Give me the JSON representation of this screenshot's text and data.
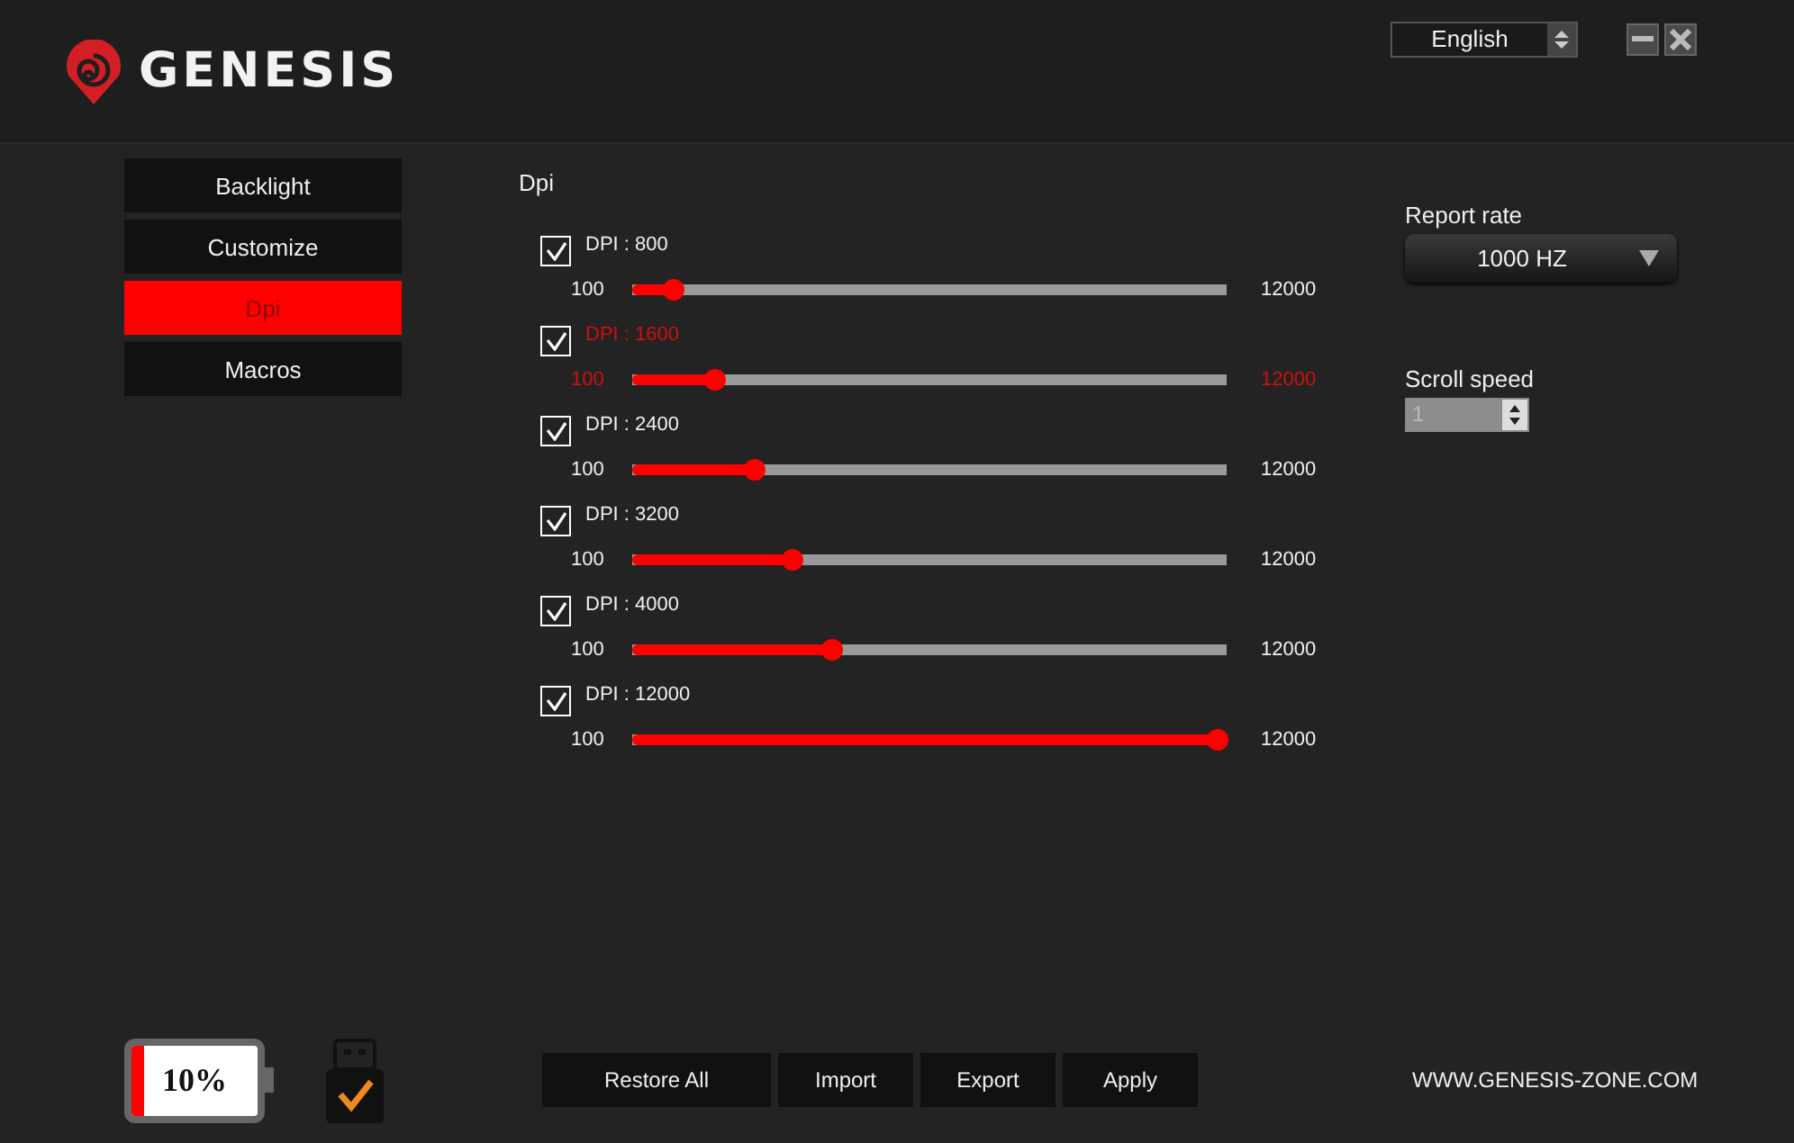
{
  "header": {
    "brand": "GENESIS",
    "language": "English"
  },
  "nav": [
    {
      "label": "Backlight",
      "selected": false
    },
    {
      "label": "Customize",
      "selected": false
    },
    {
      "label": "Dpi",
      "selected": true
    },
    {
      "label": "Macros",
      "selected": false
    }
  ],
  "dpi": {
    "title": "Dpi",
    "rows": [
      {
        "label": "DPI : 800",
        "checked": true,
        "selected": false,
        "min": "100",
        "max": "12000",
        "level": 0.07
      },
      {
        "label": "DPI : 1600",
        "checked": true,
        "selected": true,
        "min": "100",
        "max": "12000",
        "level": 0.14
      },
      {
        "label": "DPI : 2400",
        "checked": true,
        "selected": false,
        "min": "100",
        "max": "12000",
        "level": 0.205
      },
      {
        "label": "DPI : 3200",
        "checked": true,
        "selected": false,
        "min": "100",
        "max": "12000",
        "level": 0.27
      },
      {
        "label": "DPI : 4000",
        "checked": true,
        "selected": false,
        "min": "100",
        "max": "12000",
        "level": 0.335
      },
      {
        "label": "DPI : 12000",
        "checked": true,
        "selected": false,
        "min": "100",
        "max": "12000",
        "level": 0.985
      }
    ]
  },
  "report_rate": {
    "label": "Report rate",
    "value": "1000 HZ"
  },
  "scroll_speed": {
    "label": "Scroll speed",
    "value": "1"
  },
  "battery": {
    "reading": "10%",
    "level": 0.1
  },
  "buttons": [
    "Restore All",
    "Import",
    "Export",
    "Apply"
  ],
  "website": "WWW.GENESIS-ZONE.COM"
}
